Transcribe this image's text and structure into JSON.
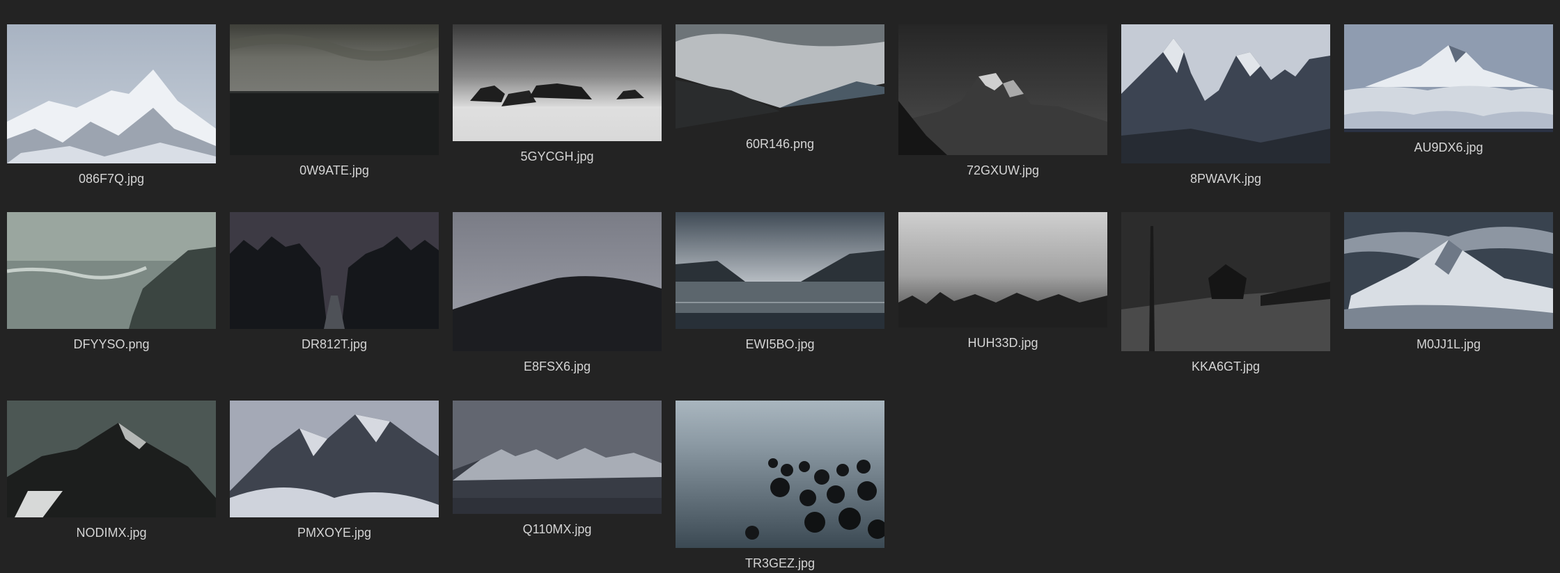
{
  "files": [
    {
      "name": "086F7Q.jpg",
      "scene": "snowy-peaks-blue-sky"
    },
    {
      "name": "0W9ATE.jpg",
      "scene": "dark-sea-overcast"
    },
    {
      "name": "5GYCGH.jpg",
      "scene": "rocks-in-mist"
    },
    {
      "name": "60R146.png",
      "scene": "dark-valley-clouds"
    },
    {
      "name": "72GXUW.jpg",
      "scene": "dark-rocky-mountain"
    },
    {
      "name": "8PWAVK.jpg",
      "scene": "granite-towers"
    },
    {
      "name": "AU9DX6.jpg",
      "scene": "snow-peak-above-clouds"
    },
    {
      "name": "DFYYSO.png",
      "scene": "sea-cliff-waves"
    },
    {
      "name": "DR812T.jpg",
      "scene": "foggy-forest-road"
    },
    {
      "name": "E8FSX6.jpg",
      "scene": "misty-forest-hill"
    },
    {
      "name": "EWI5BO.jpg",
      "scene": "lake-reflection"
    },
    {
      "name": "HUH33D.jpg",
      "scene": "foggy-treeline"
    },
    {
      "name": "KKA6GT.jpg",
      "scene": "winter-cabin"
    },
    {
      "name": "M0JJ1L.jpg",
      "scene": "snow-summit-clouds"
    },
    {
      "name": "NODIMX.jpg",
      "scene": "dark-mountain-ridge"
    },
    {
      "name": "PMXOYE.jpg",
      "scene": "misty-snow-crags"
    },
    {
      "name": "Q110MX.jpg",
      "scene": "snowy-range"
    },
    {
      "name": "TR3GEZ.jpg",
      "scene": "rocky-shore-calm-sea"
    }
  ],
  "colors": {
    "background": "#232323",
    "label": "#d4d4d4"
  }
}
